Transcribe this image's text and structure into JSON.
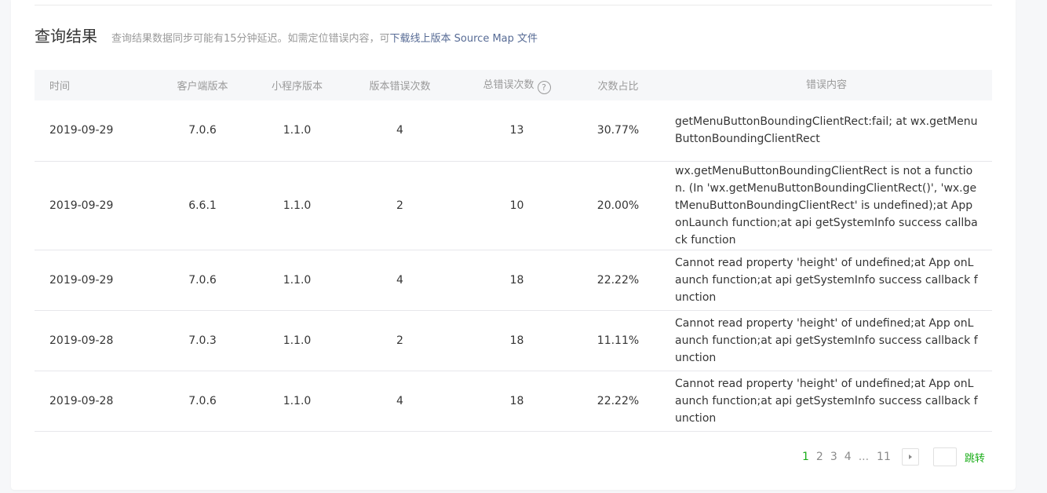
{
  "section": {
    "title": "查询结果",
    "tip": "查询结果数据同步可能有15分钟延迟。如需定位错误内容，可",
    "link": "下载线上版本 Source Map 文件"
  },
  "table": {
    "headers": {
      "time": "时间",
      "client_version": "客户端版本",
      "mp_version": "小程序版本",
      "version_errors": "版本错误次数",
      "total_errors": "总错误次数",
      "help_icon": "?",
      "ratio": "次数占比",
      "content": "错误内容"
    },
    "rows": [
      {
        "time": "2019-09-29",
        "client_version": "7.0.6",
        "mp_version": "1.1.0",
        "version_errors": "4",
        "total_errors": "13",
        "ratio": "30.77%",
        "content": "getMenuButtonBoundingClientRect:fail; at wx.getMenuButtonBoundingClientRect"
      },
      {
        "time": "2019-09-29",
        "client_version": "6.6.1",
        "mp_version": "1.1.0",
        "version_errors": "2",
        "total_errors": "10",
        "ratio": "20.00%",
        "content": "wx.getMenuButtonBoundingClientRect is not a function. (In 'wx.getMenuButtonBoundingClientRect()', 'wx.getMenuButtonBoundingClientRect' is undefined);at App onLaunch function;at api getSystemInfo success callback function"
      },
      {
        "time": "2019-09-29",
        "client_version": "7.0.6",
        "mp_version": "1.1.0",
        "version_errors": "4",
        "total_errors": "18",
        "ratio": "22.22%",
        "content": "Cannot read property 'height' of undefined;at App onLaunch function;at api getSystemInfo success callback function"
      },
      {
        "time": "2019-09-28",
        "client_version": "7.0.3",
        "mp_version": "1.1.0",
        "version_errors": "2",
        "total_errors": "18",
        "ratio": "11.11%",
        "content": "Cannot read property 'height' of undefined;at App onLaunch function;at api getSystemInfo success callback function"
      },
      {
        "time": "2019-09-28",
        "client_version": "7.0.6",
        "mp_version": "1.1.0",
        "version_errors": "4",
        "total_errors": "18",
        "ratio": "22.22%",
        "content": "Cannot read property 'height' of undefined;at App onLaunch function;at api getSystemInfo success callback function"
      }
    ]
  },
  "pagination": {
    "pages": [
      "1",
      "2",
      "3",
      "4"
    ],
    "ellipsis": "...",
    "last": "11",
    "current": "1",
    "jump_label": "跳转",
    "next_icon": "caret-right-icon"
  },
  "colors": {
    "accent_green": "#1aad19",
    "link_blue": "#576b95",
    "header_bg": "#f6f7f9"
  }
}
